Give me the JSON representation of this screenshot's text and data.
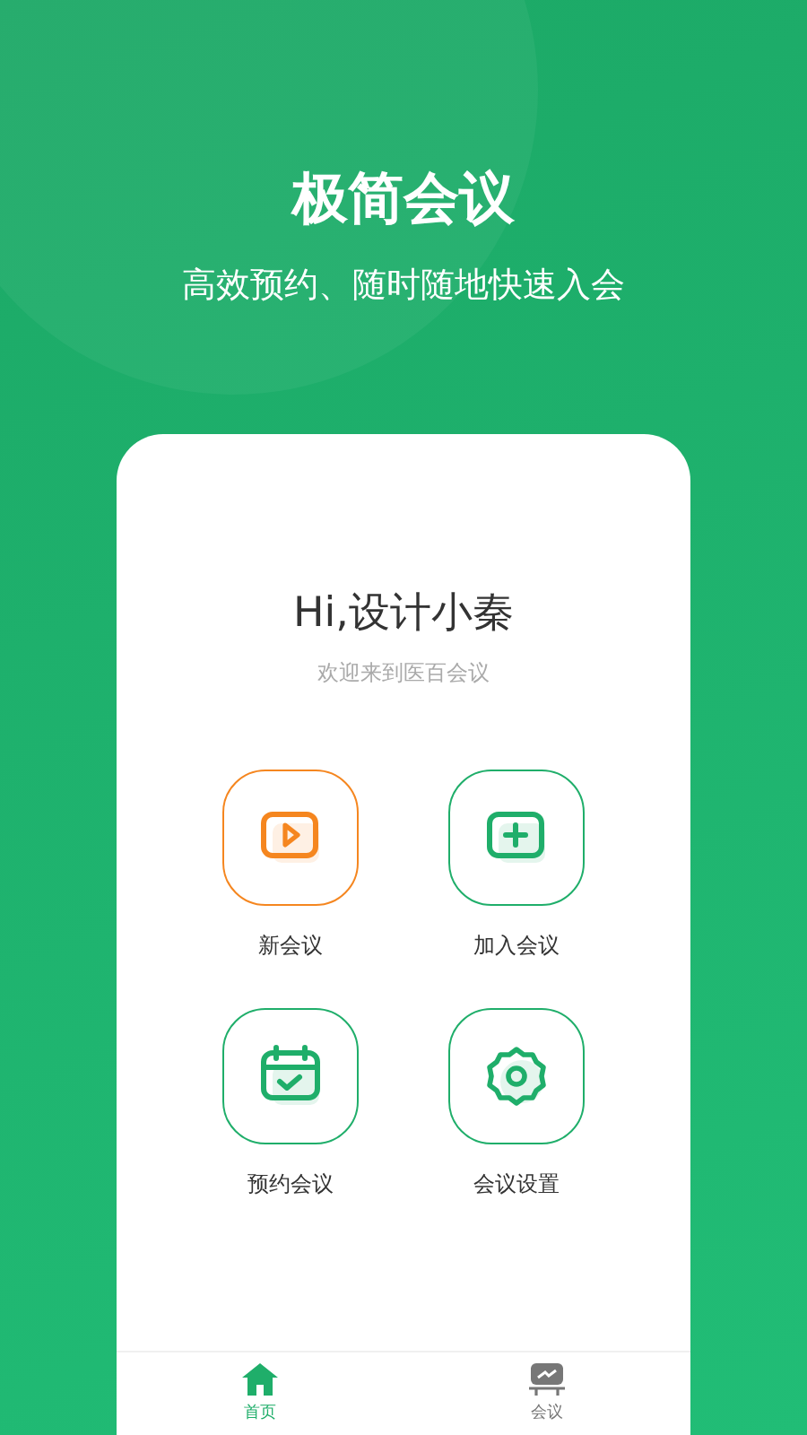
{
  "hero": {
    "title": "极简会议",
    "subtitle": "高效预约、随时随地快速入会"
  },
  "card": {
    "greeting": "Hi,设计小秦",
    "welcome": "欢迎来到医百会议"
  },
  "actions": [
    {
      "label": "新会议",
      "kind": "video",
      "color": "#f5861f"
    },
    {
      "label": "加入会议",
      "kind": "join",
      "color": "#1fae6a"
    },
    {
      "label": "预约会议",
      "kind": "calendar",
      "color": "#1fae6a"
    },
    {
      "label": "会议设置",
      "kind": "settings",
      "color": "#1fae6a"
    }
  ],
  "tab_bar": [
    {
      "label": "首页",
      "kind": "home",
      "selected": true
    },
    {
      "label": "会议",
      "kind": "meeting",
      "selected": false
    }
  ]
}
